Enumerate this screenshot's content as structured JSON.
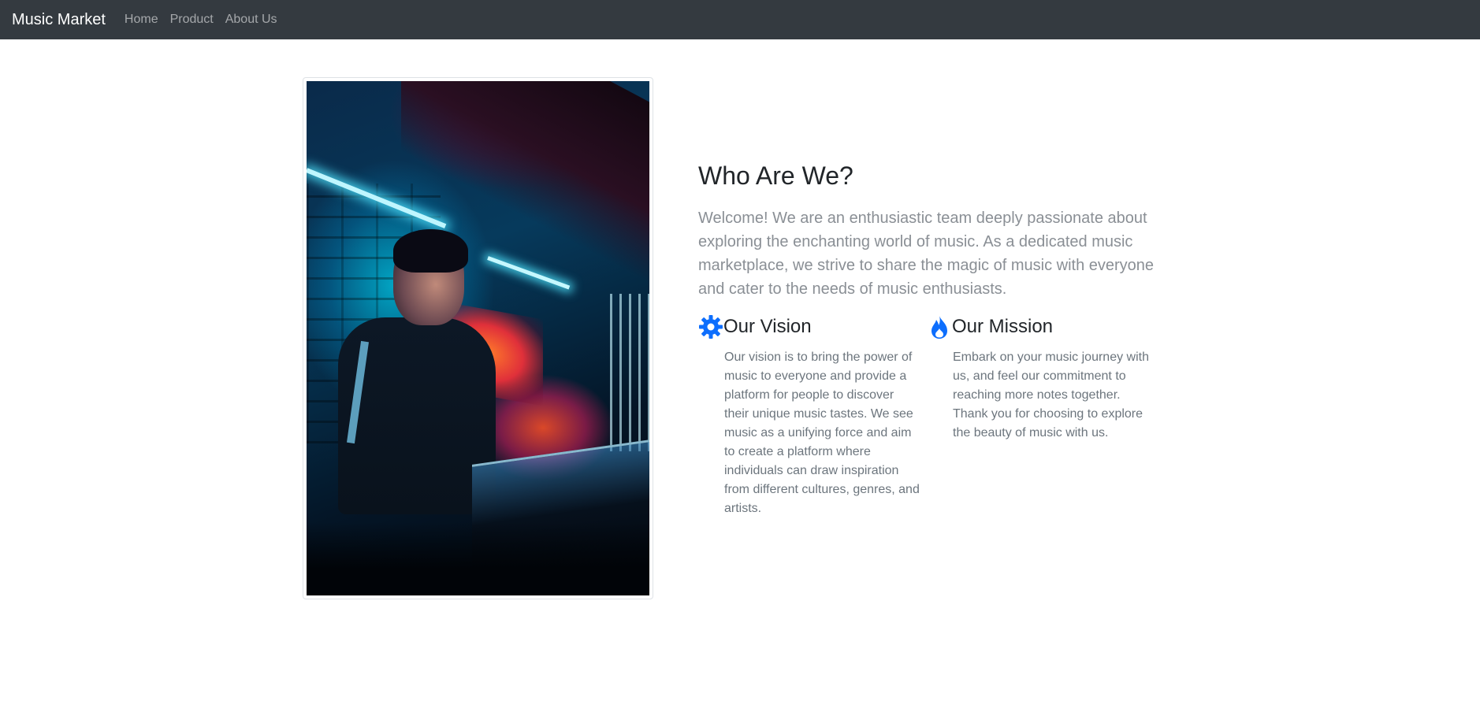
{
  "navbar": {
    "brand": "Music Market",
    "links": [
      "Home",
      "Product",
      "About Us"
    ]
  },
  "about": {
    "title": "Who Are We?",
    "lead": "Welcome! We are an enthusiastic team deeply passionate about exploring the enchanting world of music. As a dedicated music marketplace, we strive to share the magic of music with everyone and cater to the needs of music enthusiasts.",
    "vision": {
      "icon": "gear-icon",
      "title": "Our Vision",
      "text": "Our vision is to bring the power of music to everyone and provide a platform for people to discover their unique music tastes. We see music as a unifying force and aim to create a platform where individuals can draw inspiration from different cultures, genres, and artists."
    },
    "mission": {
      "icon": "fire-icon",
      "title": "Our Mission",
      "text": "Embark on your music journey with us, and feel our commitment to reaching more notes together. Thank you for choosing to explore the beauty of music with us."
    }
  },
  "colors": {
    "navbar_bg": "#343a40",
    "accent": "#0d6efd",
    "muted_text": "#6c757d"
  }
}
